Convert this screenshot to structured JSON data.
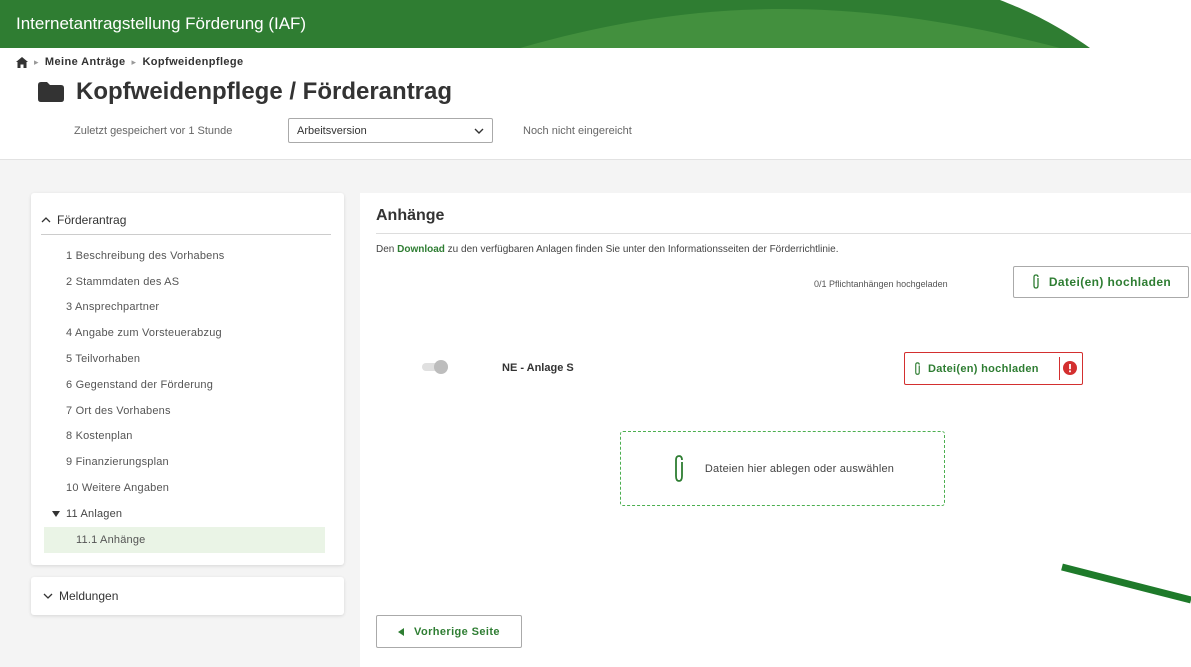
{
  "app": {
    "title": "Internetantragstellung Förderung (IAF)"
  },
  "breadcrumb": {
    "items": [
      "Meine Anträge",
      "Kopfweidenpflege"
    ]
  },
  "page": {
    "title": "Kopfweidenpflege / Förderantrag",
    "saved_text": "Zuletzt gespeichert vor 1 Stunde",
    "version_select": "Arbeitsversion",
    "status": "Noch nicht eingereicht"
  },
  "sidebar": {
    "section_label": "Förderantrag",
    "items": [
      "1 Beschreibung des Vorhabens",
      "2 Stammdaten des AS",
      "3 Ansprechpartner",
      "4 Angabe zum Vorsteuerabzug",
      "5 Teilvorhaben",
      "6 Gegenstand der Förderung",
      "7 Ort des Vorhabens",
      "8 Kostenplan",
      "9 Finanzierungsplan",
      "10 Weitere Angaben"
    ],
    "group_label": "11 Anlagen",
    "active_item": "11.1 Anhänge",
    "meldungen_label": "Meldungen"
  },
  "main": {
    "heading": "Anhänge",
    "info_before": "Den ",
    "info_link": "Download",
    "info_after": " zu den verfügbaren Anlagen finden Sie unter den Informationsseiten der Förderrichtlinie.",
    "counter": "0/1 Pflichtanhängen hochgeladen",
    "upload_label": "Datei(en) hochladen",
    "attachment_name": "NE - Anlage S",
    "attachment_upload_label": "Datei(en) hochladen",
    "dropzone_text": "Dateien hier ablegen oder auswählen",
    "prev_label": "Vorherige Seite"
  },
  "colors": {
    "brand_green": "#2f7d32",
    "accent_green": "#2e7d32",
    "error_red": "#d32f2f"
  }
}
